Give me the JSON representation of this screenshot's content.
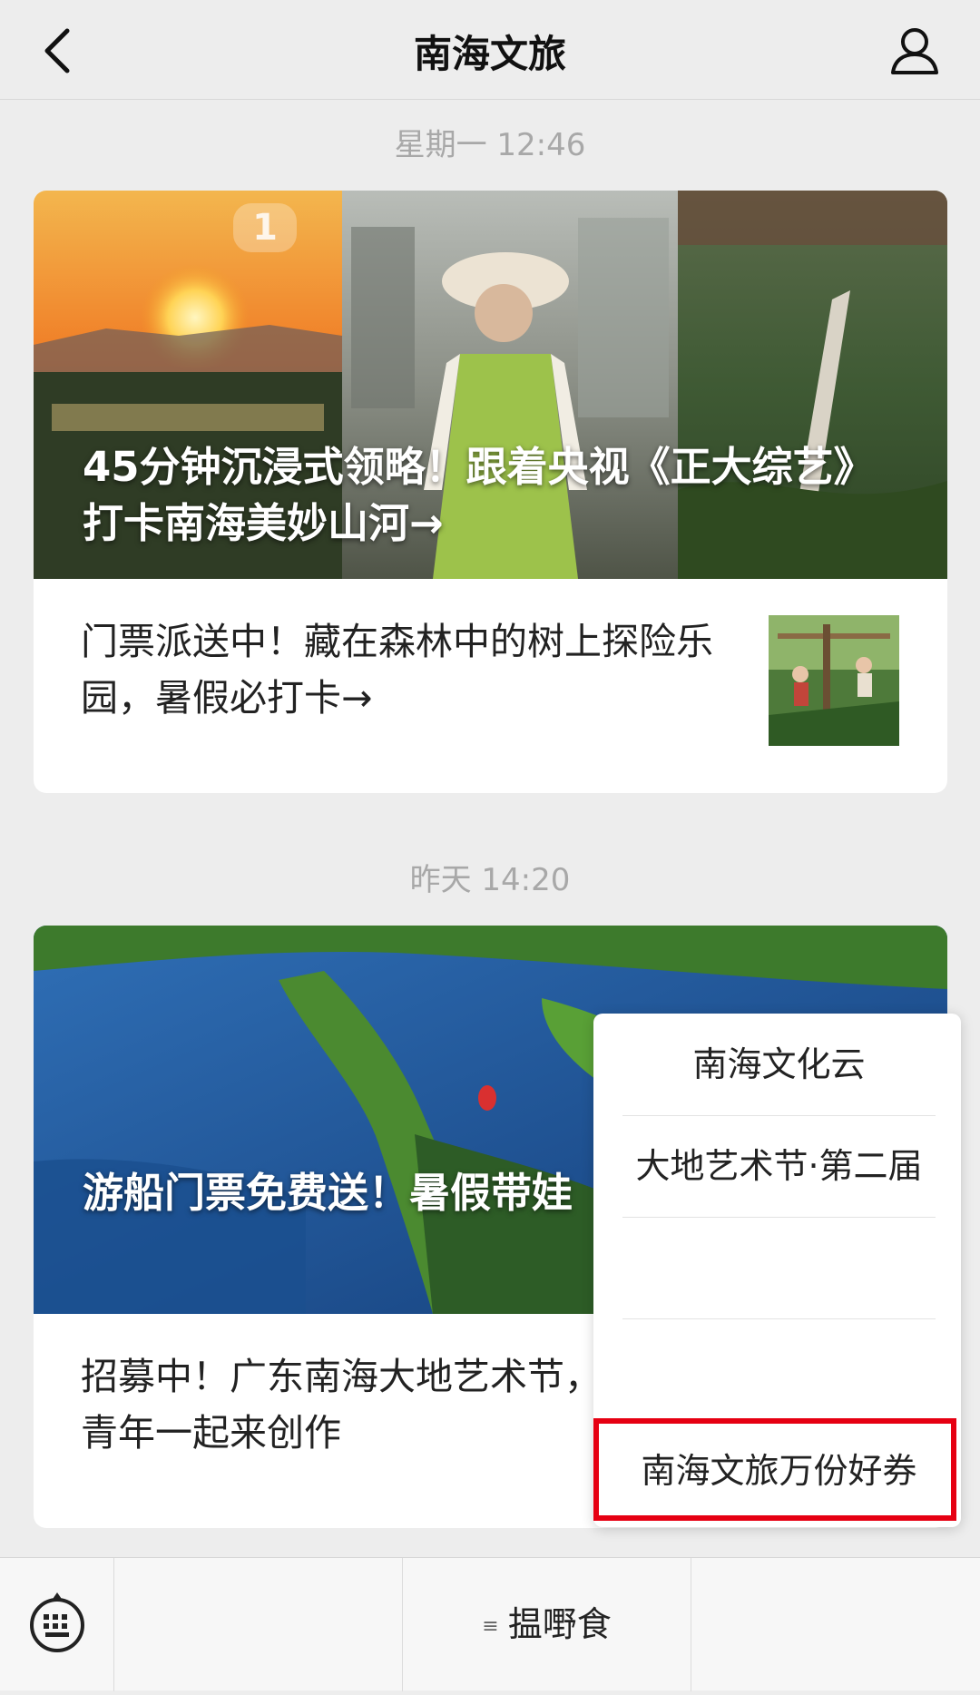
{
  "nav": {
    "title": "南海文旅"
  },
  "messages": [
    {
      "time": "星期一 12:46",
      "hero_badge": "1",
      "hero_title": "45分钟沉浸式领略！跟着央视《正大综艺》打卡南海美妙山河→",
      "sub_title": "门票派送中！藏在森林中的树上探险乐园，暑假必打卡→"
    },
    {
      "time": "昨天 14:20",
      "hero_title": "游船门票免费送！暑假带娃",
      "sub_title": "招募中！广东南海大地艺术节，大湾区青年一起来创作"
    }
  ],
  "menu": {
    "items": [
      "南海文化云",
      "大地艺术节·第二届",
      "",
      "",
      "南海文旅万份好券"
    ]
  },
  "bottom_bar": {
    "menus": [
      "",
      "揾嘢食",
      ""
    ]
  },
  "colors": {
    "highlight": "#e60012",
    "background": "#ededed"
  }
}
